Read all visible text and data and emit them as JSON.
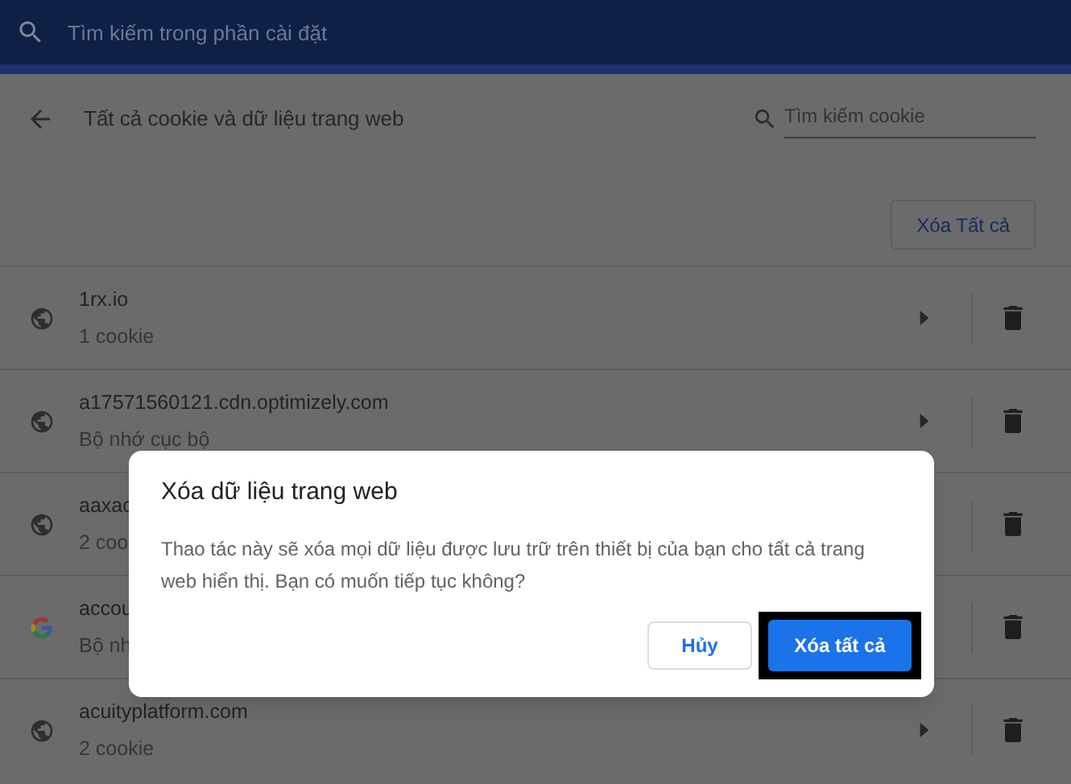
{
  "top_bar": {
    "search_placeholder": "Tìm kiếm trong phần cài đặt"
  },
  "header": {
    "title": "Tất cả cookie và dữ liệu trang web",
    "search_placeholder": "Tìm kiếm cookie"
  },
  "remove_all_button": "Xóa Tất cả",
  "sites": [
    {
      "kind": "globe",
      "name": "1rx.io",
      "detail": "1 cookie",
      "expandable": true
    },
    {
      "kind": "globe",
      "name": "a17571560121.cdn.optimizely.com",
      "detail": "Bộ nhớ cục bộ",
      "expandable": true
    },
    {
      "kind": "globe",
      "name": "aaxac",
      "detail": "2 coo",
      "expandable": false
    },
    {
      "kind": "google",
      "name": "accou",
      "detail": "Bộ nh",
      "expandable": false
    },
    {
      "kind": "globe",
      "name": "acuityplatform.com",
      "detail": "2 cookie",
      "expandable": true
    }
  ],
  "dialog": {
    "title": "Xóa dữ liệu trang web",
    "message": "Thao tác này sẽ xóa mọi dữ liệu được lưu trữ trên thiết bị của bạn cho tất cả trang web hiển thị. Bạn có muốn tiếp tục không?",
    "cancel": "Hủy",
    "confirm": "Xóa tất cả"
  }
}
